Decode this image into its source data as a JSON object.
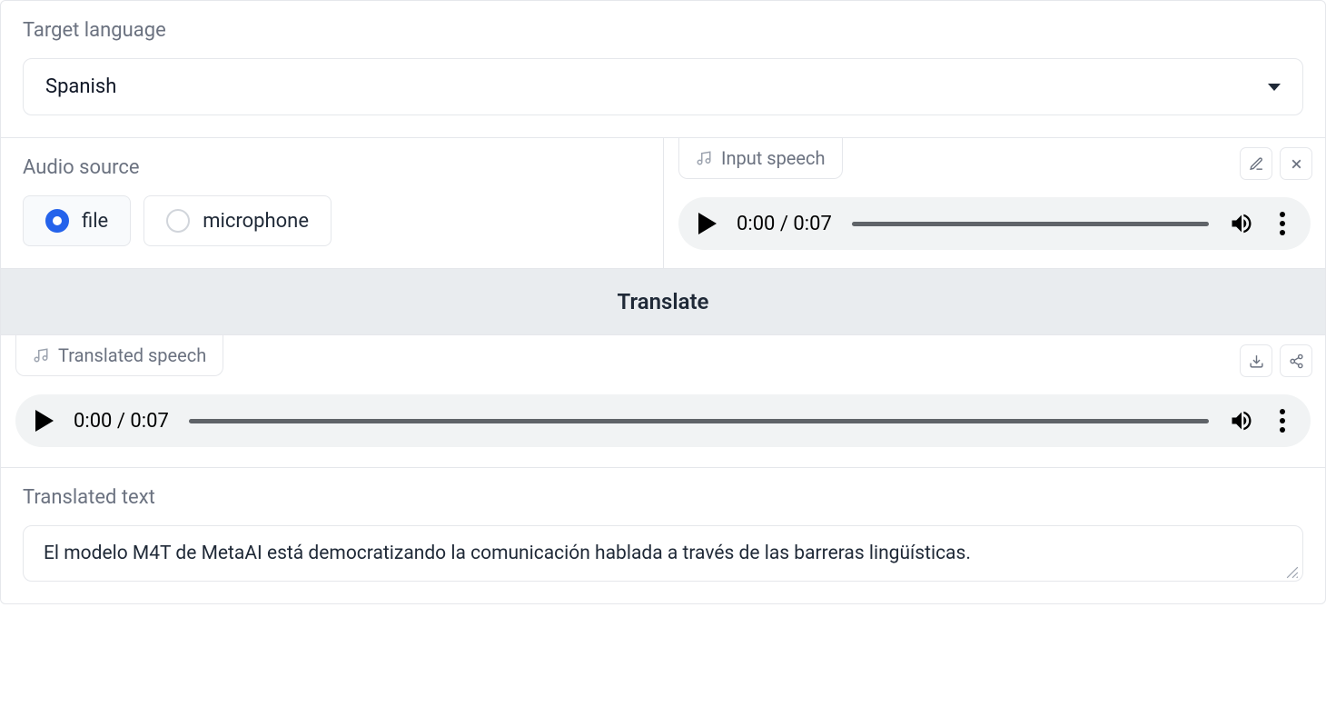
{
  "targetLanguage": {
    "label": "Target language",
    "value": "Spanish"
  },
  "audioSource": {
    "label": "Audio source",
    "options": {
      "file": "file",
      "microphone": "microphone"
    },
    "selected": "file"
  },
  "inputSpeech": {
    "tabLabel": "Input speech",
    "time": "0:00 / 0:07"
  },
  "translateButton": "Translate",
  "translatedSpeech": {
    "tabLabel": "Translated speech",
    "time": "0:00 / 0:07"
  },
  "translatedText": {
    "label": "Translated text",
    "value": "El modelo M4T de MetaAI está democratizando la comunicación hablada a través de las barreras lingüísticas."
  }
}
